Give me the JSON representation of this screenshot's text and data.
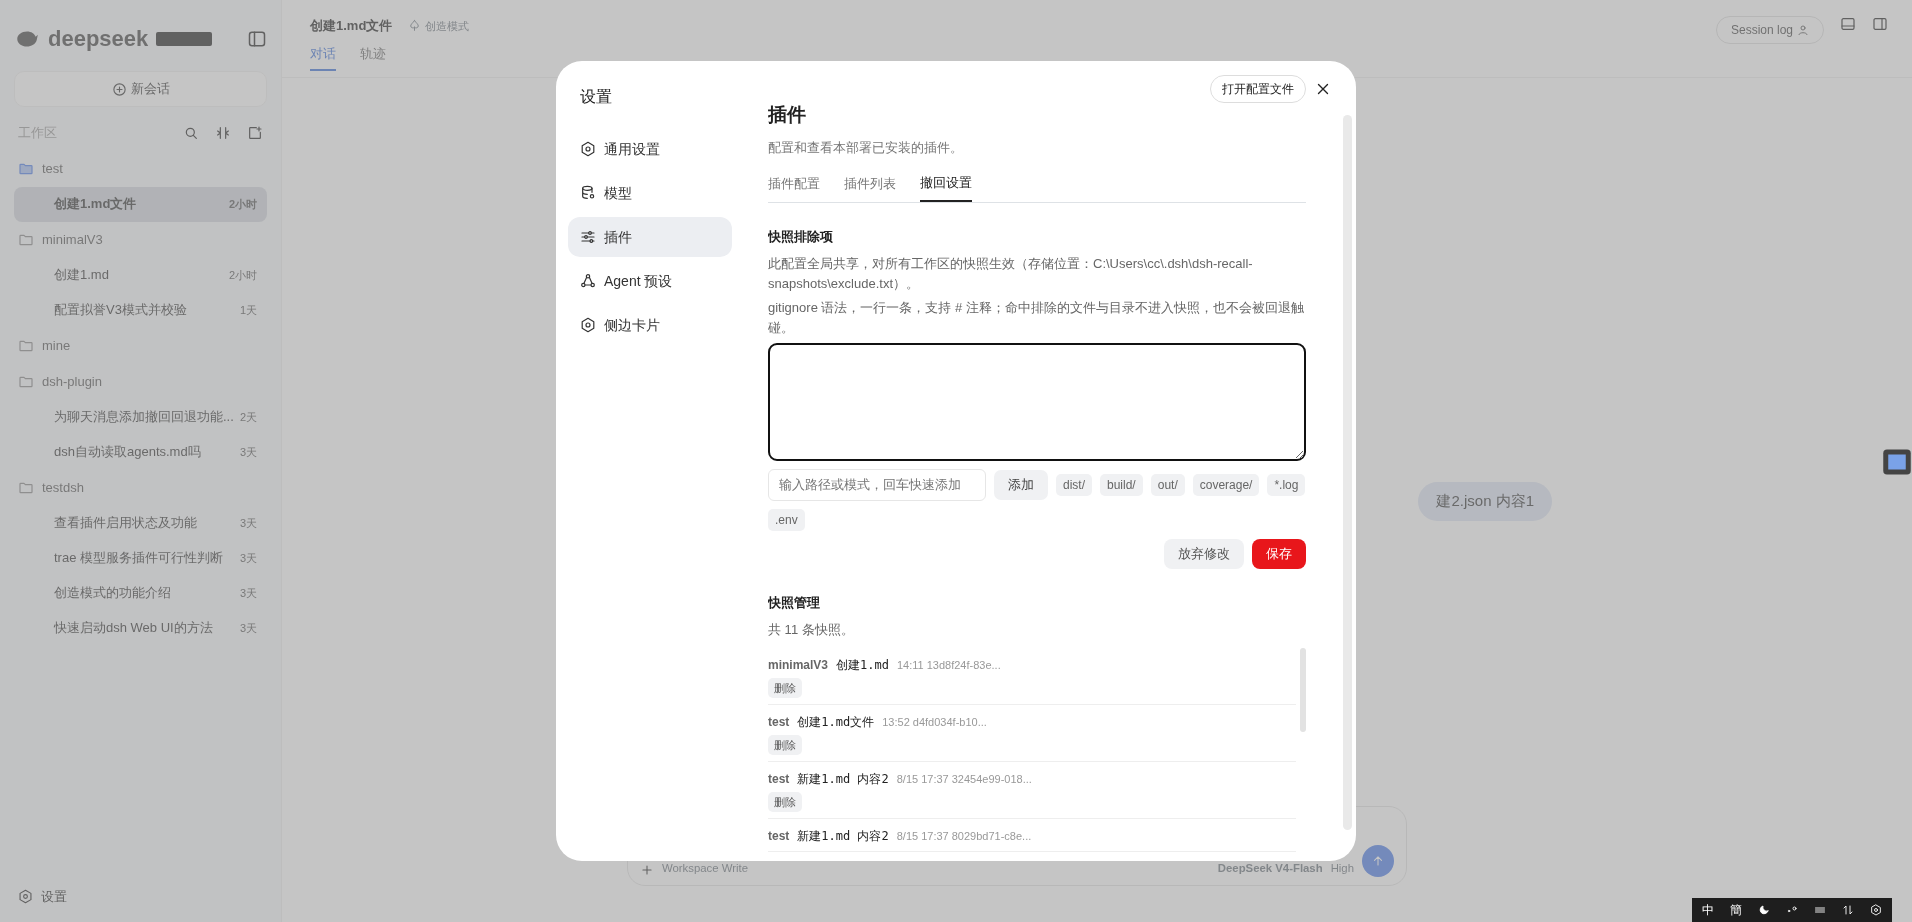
{
  "sidebar": {
    "logo": "deepseek",
    "new_chat": "新会话",
    "workspace_label": "工作区",
    "folders": [
      {
        "name": "test",
        "active": true,
        "sessions": [
          {
            "title": "创建1.md文件",
            "time": "2小时",
            "selected": true
          }
        ]
      },
      {
        "name": "minimalV3",
        "active": false,
        "sessions": [
          {
            "title": "创建1.md",
            "time": "2小时",
            "selected": false
          },
          {
            "title": "配置拟誉V3模式并校验",
            "time": "1天",
            "selected": false
          }
        ]
      },
      {
        "name": "mine",
        "active": false
      },
      {
        "name": "dsh-plugin",
        "active": false,
        "sessions": [
          {
            "title": "为聊天消息添加撤回回退功能...",
            "time": "2天",
            "selected": false
          },
          {
            "title": "dsh自动读取agents.md吗",
            "time": "3天",
            "selected": false
          }
        ]
      },
      {
        "name": "testdsh",
        "active": false,
        "sessions": [
          {
            "title": "查看插件启用状态及功能",
            "time": "3天",
            "selected": false
          },
          {
            "title": "trae 模型服务插件可行性判断",
            "time": "3天",
            "selected": false
          },
          {
            "title": "创造模式的功能介绍",
            "time": "3天",
            "selected": false
          },
          {
            "title": "快速启动dsh Web UI的方法",
            "time": "3天",
            "selected": false
          }
        ]
      }
    ],
    "footer": "设置"
  },
  "header": {
    "title": "创建1.md文件",
    "mode": "创造模式",
    "session_log": "Session log",
    "tabs": [
      {
        "label": "对话",
        "selected": true
      },
      {
        "label": "轨迹",
        "selected": false
      }
    ]
  },
  "chat": {
    "bubble": "建2.json 内容1",
    "composer": {
      "permission": "Workspace Write",
      "model": "DeepSeek V4-Flash",
      "effort": "High"
    }
  },
  "ime": {
    "keys": [
      "中",
      "簡"
    ]
  },
  "modal": {
    "title": "设置",
    "open_config": "打开配置文件",
    "nav": [
      {
        "label": "通用设置",
        "selected": false
      },
      {
        "label": "模型",
        "selected": false
      },
      {
        "label": "插件",
        "selected": true
      },
      {
        "label": "Agent 预设",
        "selected": false
      },
      {
        "label": "侧边卡片",
        "selected": false
      }
    ],
    "page_title": "插件",
    "page_subtitle": "配置和查看本部署已安装的插件。",
    "tabs": [
      {
        "label": "插件配置",
        "selected": false
      },
      {
        "label": "插件列表",
        "selected": false
      },
      {
        "label": "撤回设置",
        "selected": true
      }
    ],
    "exclude": {
      "heading": "快照排除项",
      "notes": [
        "此配置全局共享，对所有工作区的快照生效（存储位置：C:\\Users\\cc\\.dsh\\dsh-recall-snapshots\\exclude.txt）。",
        "gitignore 语法，一行一条，支持 # 注释；命中排除的文件与目录不进入快照，也不会被回退触碰。"
      ],
      "pattern_placeholder": "输入路径或模式，回车快速添加",
      "add": "添加",
      "chips": [
        "dist/",
        "build/",
        "out/",
        "coverage/",
        "*.log",
        ".env"
      ],
      "discard": "放弃修改",
      "save": "保存"
    },
    "snapshots": {
      "heading": "快照管理",
      "count": "共 11 条快照。",
      "items": [
        {
          "workspace": "minimalV3",
          "title": "创建1.md",
          "meta": "14:11 13d8f24f-83e...",
          "delete": "删除"
        },
        {
          "workspace": "test",
          "title": "创建1.md文件",
          "meta": "13:52 d4fd034f-b10...",
          "delete": "删除"
        },
        {
          "workspace": "test",
          "title": "新建1.md 内容2",
          "meta": "8/15 17:37 32454e99-018...",
          "delete": "删除"
        },
        {
          "workspace": "test",
          "title": "新建1.md 内容2",
          "meta": "8/15 17:37 8029bd71-c8e..."
        }
      ]
    }
  }
}
